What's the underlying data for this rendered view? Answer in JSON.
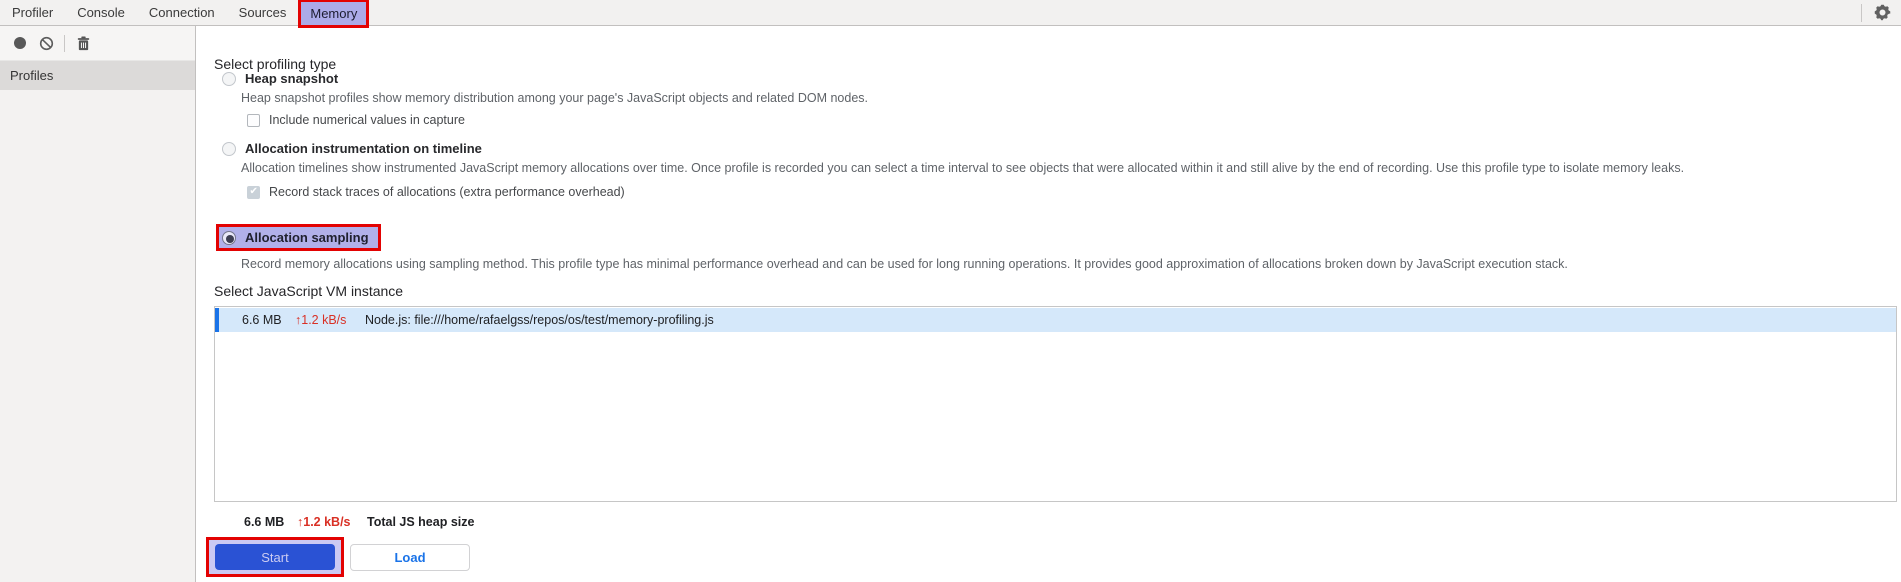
{
  "tabs": {
    "items": [
      {
        "label": "Profiler",
        "selected": false
      },
      {
        "label": "Console",
        "selected": false
      },
      {
        "label": "Connection",
        "selected": false
      },
      {
        "label": "Sources",
        "selected": false
      },
      {
        "label": "Memory",
        "selected": true,
        "annotated": true
      }
    ],
    "settings_icon": "gear-icon"
  },
  "toolbar": {
    "icons": [
      {
        "name": "record-icon"
      },
      {
        "name": "clear-icon"
      },
      {
        "name": "trash-icon"
      }
    ]
  },
  "sidebar": {
    "profiles_header": "Profiles"
  },
  "profiling": {
    "heading": "Select profiling type",
    "options": [
      {
        "label": "Heap snapshot",
        "selected": false,
        "description": "Heap snapshot profiles show memory distribution among your page's JavaScript objects and related DOM nodes.",
        "checkbox": {
          "label": "Include numerical values in capture",
          "checked": false,
          "disabled": false
        }
      },
      {
        "label": "Allocation instrumentation on timeline",
        "selected": false,
        "description": "Allocation timelines show instrumented JavaScript memory allocations over time. Once profile is recorded you can select a time interval to see objects that were allocated within it and still alive by the end of recording. Use this profile type to isolate memory leaks.",
        "checkbox": {
          "label": "Record stack traces of allocations (extra performance overhead)",
          "checked": true,
          "disabled": true
        }
      },
      {
        "label": "Allocation sampling",
        "selected": true,
        "annotated": true,
        "description": "Record memory allocations using sampling method. This profile type has minimal performance overhead and can be used for long running operations. It provides good approximation of allocations broken down by JavaScript execution stack."
      }
    ]
  },
  "vm": {
    "heading": "Select JavaScript VM instance",
    "rows": [
      {
        "size": "6.6 MB",
        "rate": "↑1.2 kB/s",
        "name": "Node.js: file:///home/rafaelgss/repos/os/test/memory-profiling.js",
        "selected": true
      }
    ]
  },
  "footer": {
    "size": "6.6 MB",
    "rate": "↑1.2 kB/s",
    "label": "Total JS heap size"
  },
  "actions": {
    "start": "Start",
    "load": "Load"
  },
  "colors": {
    "accent_blue": "#1a73e8",
    "selected_row_bg": "#d5e8fa",
    "rate_red": "#d93025",
    "annotation_border": "#e30202",
    "annotation_fill": "#b1b0e9",
    "start_button_bg": "#2a52d4"
  }
}
